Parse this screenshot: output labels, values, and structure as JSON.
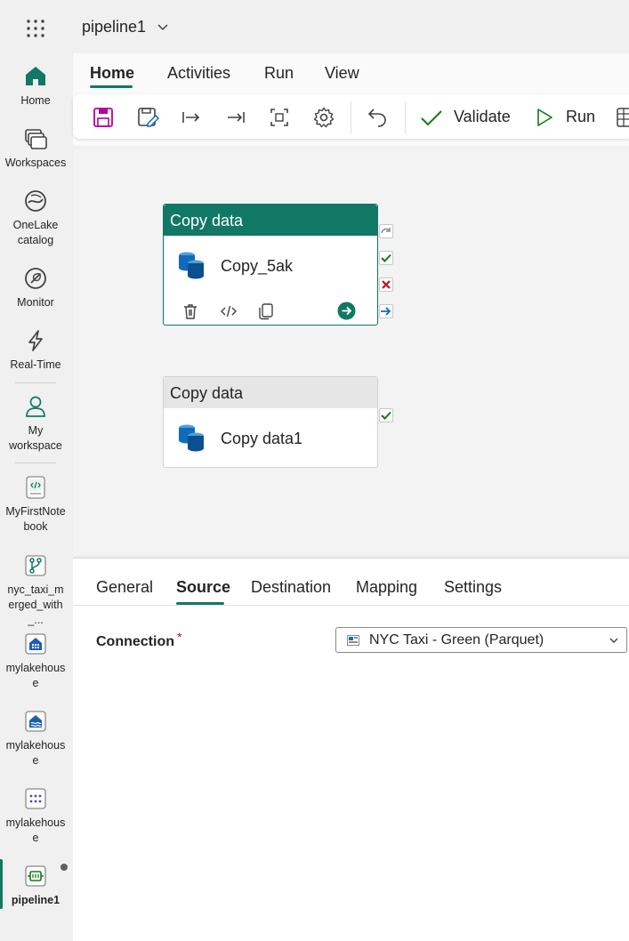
{
  "app": {
    "title": "pipeline1"
  },
  "rail": {
    "items": [
      {
        "label": "Home",
        "icon": "home-icon"
      },
      {
        "label": "Workspaces",
        "icon": "workspaces-icon"
      },
      {
        "label": "OneLake catalog",
        "icon": "onelake-icon"
      },
      {
        "label": "Monitor",
        "icon": "monitor-icon"
      },
      {
        "label": "Real-Time",
        "icon": "lightning-icon"
      },
      {
        "label": "My workspace",
        "icon": "person-icon"
      },
      {
        "label": "MyFirstNotebook",
        "icon": "notebook-icon"
      },
      {
        "label": "nyc_taxi_merged_with_...",
        "icon": "pipeline-branch-icon"
      },
      {
        "label": "mylakehouse",
        "icon": "lakehouse-icon"
      },
      {
        "label": "mylakehouse",
        "icon": "lakehouse-icon"
      },
      {
        "label": "mylakehouse",
        "icon": "dots-grid-icon"
      },
      {
        "label": "pipeline1",
        "icon": "pipeline-icon"
      }
    ]
  },
  "ribbon": {
    "tabs": [
      "Home",
      "Activities",
      "Run",
      "View"
    ],
    "selected_tab": "Home",
    "validate_label": "Validate",
    "run_label": "Run"
  },
  "canvas": {
    "activities": [
      {
        "type_label": "Copy data",
        "name": "Copy_5ak",
        "selected": true
      },
      {
        "type_label": "Copy data",
        "name": "Copy data1",
        "selected": false
      }
    ]
  },
  "panel": {
    "tabs": [
      "General",
      "Source",
      "Destination",
      "Mapping",
      "Settings"
    ],
    "selected_tab": "Source",
    "connection_label": "Connection",
    "required_mark": "*",
    "connection_value": "NYC Taxi - Green (Parquet)"
  },
  "colors": {
    "accent": "#117865",
    "success": "#107c10",
    "error": "#c50f1f",
    "link": "#0f6cbd"
  }
}
